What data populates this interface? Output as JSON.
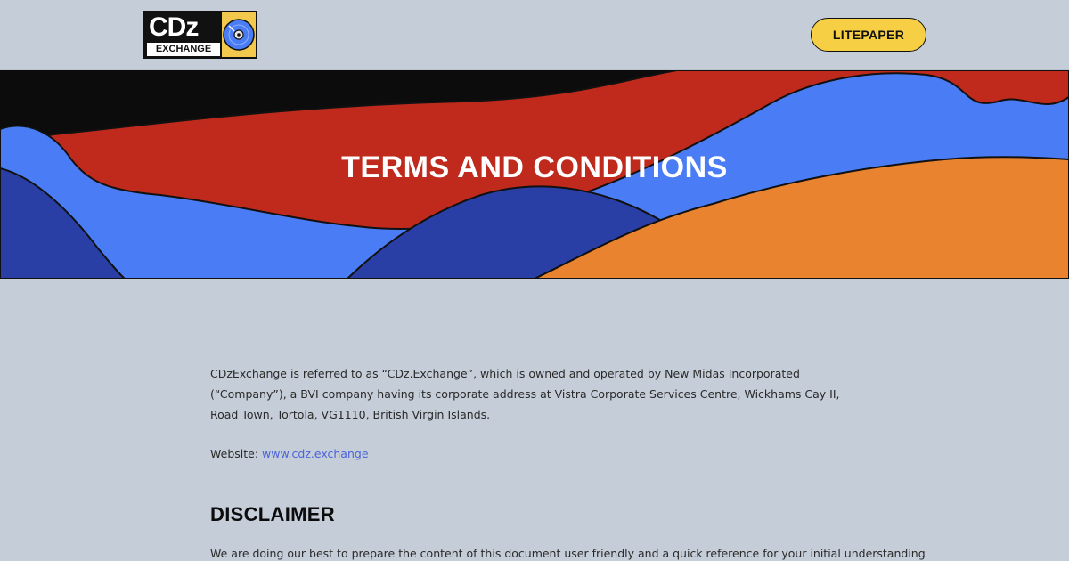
{
  "header": {
    "logo": {
      "top_text": "CDz",
      "bottom_text": "EXCHANGE"
    },
    "litepaper_label": "LITEPAPER"
  },
  "hero": {
    "title": "TERMS AND CONDITIONS",
    "colors": {
      "black": "#0c0c0c",
      "red": "#bf2a1c",
      "blue": "#4a7df5",
      "navy": "#2a3fa6",
      "orange": "#e98330"
    }
  },
  "content": {
    "intro": "CDzExchange is referred to as “CDz.Exchange”, which is owned and operated by New Midas Incorporated (“Company”), a BVI company having its corporate address at Vistra Corporate Services Centre, Wickhams Cay II, Road Town, Tortola, VG1110, British Virgin Islands.",
    "website_label": "Website: ",
    "website_link": "www.cdz.exchange",
    "disclaimer_heading": "DISCLAIMER",
    "disclaimer_text": "We are doing our best to prepare the content of this document user friendly and a quick reference for your initial understanding"
  },
  "colors": {
    "background": "#c5cdd8",
    "accent": "#f7cf45",
    "link": "#4a63d8"
  }
}
